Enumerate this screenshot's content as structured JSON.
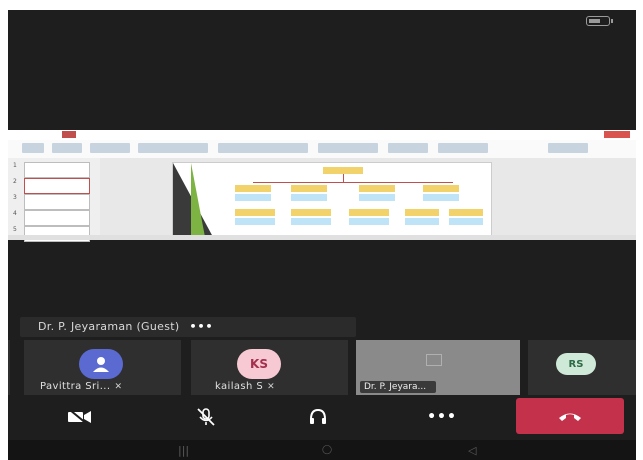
{
  "status_bar": {
    "battery_level": 0.6,
    "battery_color": "#9a9a9a"
  },
  "shared_screen": {
    "app": "PowerPoint",
    "slide_count_visible": 5,
    "colors": {
      "accent": "#c0504d",
      "box_yellow": "#f2d36b",
      "box_blue": "#bfe3f7",
      "stripe_dark": "#3a3a3a",
      "stripe_green": "#7cb342"
    }
  },
  "presenter": {
    "name": "Dr. P. Jeyaraman (Guest)",
    "more_label": "•••"
  },
  "participants": [
    {
      "label": "Pavittra Sri...",
      "initials": "",
      "avatar_color": "#5b6ad0",
      "muted": true
    },
    {
      "label": "kailash S",
      "initials": "KS",
      "avatar_color": "#f6c9d3",
      "muted": true
    },
    {
      "label": "Dr. P. Jeyara...",
      "initials": "",
      "avatar_color": "#8a8a8a",
      "muted": false
    },
    {
      "label": "",
      "initials": "RS",
      "avatar_color": "#cfe9d9",
      "muted": false
    }
  ],
  "controls": {
    "camera_icon": "video-off-icon",
    "mic_icon": "mic-off-icon",
    "audio_icon": "headset-icon",
    "more_label": "•••",
    "end_call_icon": "phone-hangup-icon",
    "end_call_color": "#c4314b"
  },
  "navbar": {
    "recent": "|||",
    "home": "◯",
    "back": "◁"
  }
}
